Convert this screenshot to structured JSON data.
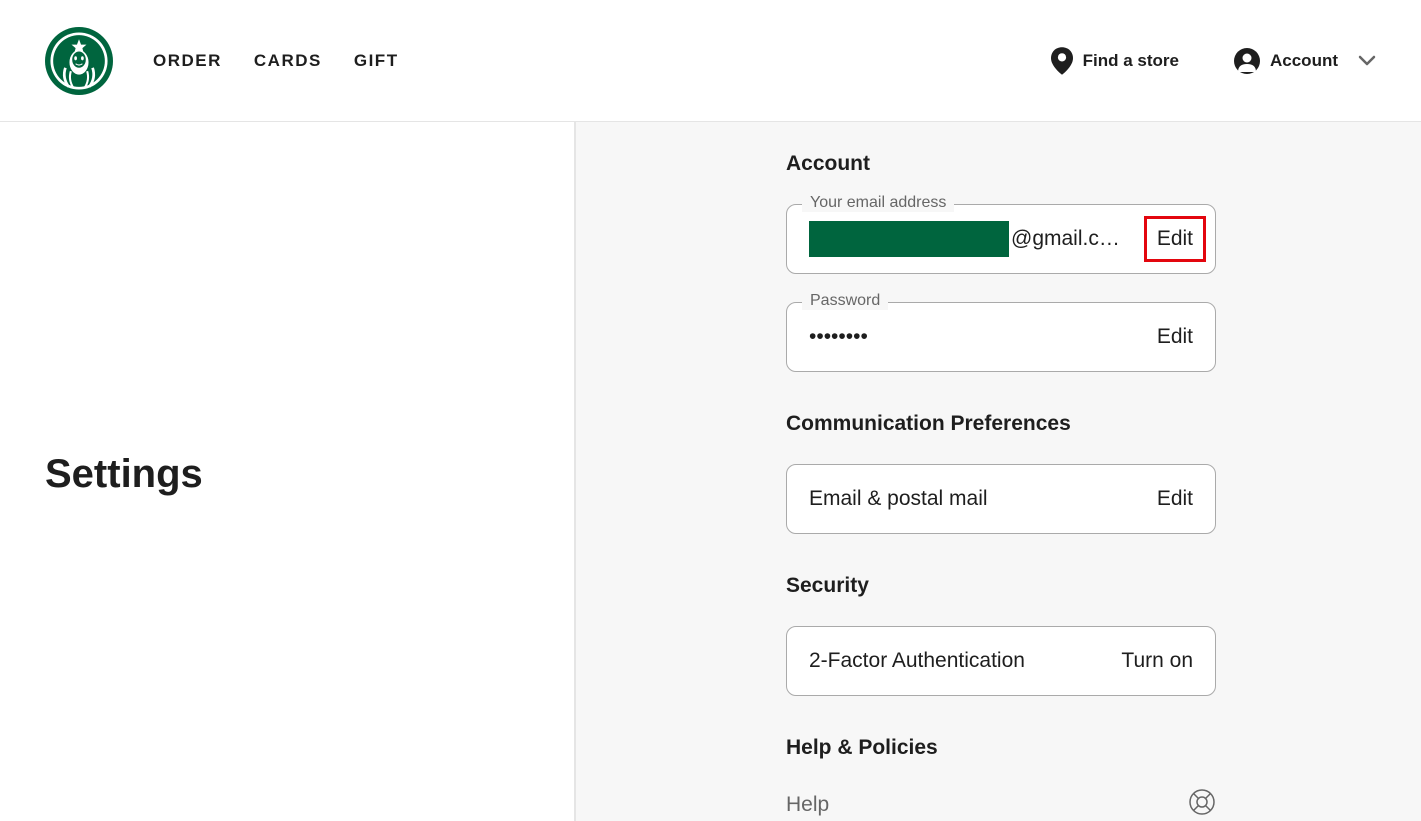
{
  "header": {
    "nav": {
      "order": "ORDER",
      "cards": "CARDS",
      "gift": "GIFT"
    },
    "find_store": "Find a store",
    "account": "Account"
  },
  "sidebar": {
    "title": "Settings"
  },
  "content": {
    "account": {
      "title": "Account",
      "email": {
        "label": "Your email address",
        "suffix": "@gmail.c…",
        "edit": "Edit"
      },
      "password": {
        "label": "Password",
        "value": "••••••••",
        "edit": "Edit"
      }
    },
    "comm": {
      "title": "Communication Preferences",
      "item": {
        "label": "Email & postal mail",
        "action": "Edit"
      }
    },
    "security": {
      "title": "Security",
      "item": {
        "label": "2-Factor Authentication",
        "action": "Turn on"
      }
    },
    "help": {
      "title": "Help & Policies",
      "item": "Help"
    }
  }
}
